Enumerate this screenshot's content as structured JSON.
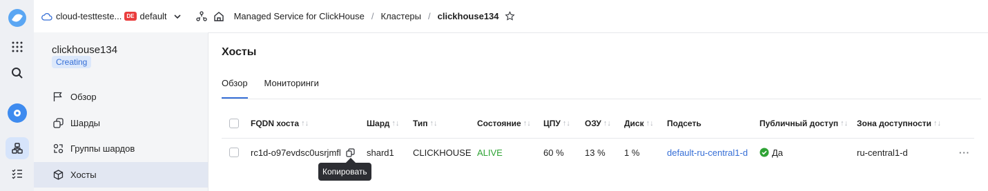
{
  "topbar": {
    "cloud": "cloud-testteste...",
    "folder_badge": "DE",
    "folder": "default",
    "breadcrumb": [
      "Managed Service for ClickHouse",
      "Кластеры",
      "clickhouse134"
    ]
  },
  "sidebar": {
    "cluster_name": "clickhouse134",
    "status": "Creating",
    "items": [
      {
        "label": "Обзор",
        "icon": "flag-icon"
      },
      {
        "label": "Шарды",
        "icon": "shards-icon"
      },
      {
        "label": "Группы шардов",
        "icon": "shard-groups-icon"
      },
      {
        "label": "Хосты",
        "icon": "hosts-icon",
        "active": true
      }
    ]
  },
  "main": {
    "title": "Хосты",
    "tabs": [
      {
        "label": "Обзор",
        "active": true
      },
      {
        "label": "Мониторинги",
        "active": false
      }
    ],
    "columns": [
      "FQDN хоста",
      "Шард",
      "Тип",
      "Состояние",
      "ЦПУ",
      "ОЗУ",
      "Диск",
      "Подсеть",
      "Публичный доступ",
      "Зона доступности"
    ],
    "rows": [
      {
        "fqdn": "rc1d-o97evdsc0usrjmfl",
        "shard": "shard1",
        "type": "CLICKHOUSE",
        "state": "ALIVE",
        "cpu": "60 %",
        "ram": "13 %",
        "disk": "1 %",
        "subnet": "default-ru-central1-d",
        "public_access": "Да",
        "zone": "ru-central1-d"
      }
    ],
    "tooltip": "Копировать"
  },
  "colors": {
    "accent": "#356ed6",
    "alive": "#2fa335",
    "rail_bg": "#eef0f4",
    "sidebar_bg": "#f4f5f7"
  }
}
